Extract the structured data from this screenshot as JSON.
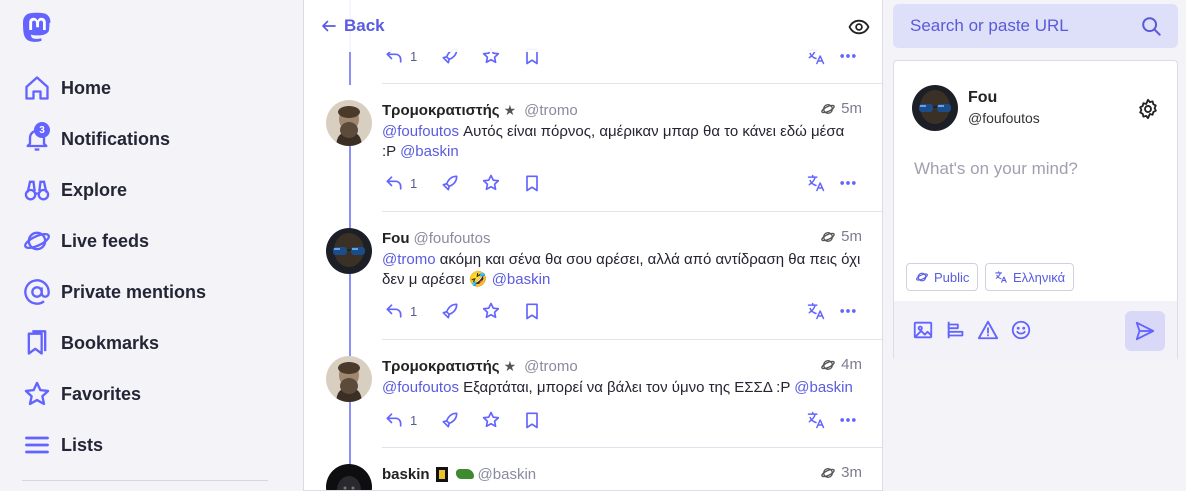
{
  "nav": {
    "items": [
      {
        "label": "Home",
        "icon": "home-icon"
      },
      {
        "label": "Notifications",
        "icon": "bell-icon",
        "badge": "3"
      },
      {
        "label": "Explore",
        "icon": "binoculars-icon"
      },
      {
        "label": "Live feeds",
        "icon": "planet-icon"
      },
      {
        "label": "Private mentions",
        "icon": "at-icon"
      },
      {
        "label": "Bookmarks",
        "icon": "bookmarks-icon"
      },
      {
        "label": "Favorites",
        "icon": "star-icon"
      },
      {
        "label": "Lists",
        "icon": "list-icon"
      }
    ]
  },
  "column": {
    "back_label": "Back",
    "statuses": [
      {
        "display_name": "Τρομοκρατιστής",
        "star": "★",
        "acct": "@tromo",
        "time": "5m",
        "content": [
          {
            "t": "@foufoutos",
            "m": true
          },
          {
            "t": " Αυτός είναι πόρνος, αμέρικαν μπαρ θα το κάνει εδώ μέσα :P ",
            "m": false
          },
          {
            "t": "@baskin",
            "m": true
          }
        ],
        "reply_count": "1"
      },
      {
        "display_name": "Fou",
        "star": "",
        "acct": "@foufoutos",
        "time": "5m",
        "content": [
          {
            "t": "@tromo",
            "m": true
          },
          {
            "t": " ακόμη και σένα θα σου αρέσει, αλλά από αντίδραση θα πεις όχι δεν μ αρέσει 🤣 ",
            "m": false
          },
          {
            "t": "@baskin",
            "m": true
          }
        ],
        "reply_count": "1"
      },
      {
        "display_name": "Τρομοκρατιστής",
        "star": "★",
        "acct": "@tromo",
        "time": "4m",
        "content": [
          {
            "t": "@foufoutos",
            "m": true
          },
          {
            "t": " Εξαρτάται, μπορεί να βάλει τον ύμνο της ΕΣΣΔ :P ",
            "m": false
          },
          {
            "t": "@baskin",
            "m": true
          }
        ],
        "reply_count": "1"
      },
      {
        "display_name": "baskin",
        "star": "",
        "acct": "@baskin",
        "time": "3m",
        "content": [],
        "reply_count": ""
      }
    ],
    "top_reply_count": "1"
  },
  "search": {
    "placeholder": "Search or paste URL"
  },
  "compose": {
    "name": "Fou",
    "acct": "@foufoutos",
    "placeholder": "What's on your mind?",
    "visibility": "Public",
    "language": "Ελληνικά"
  },
  "colors": {
    "accent": "#6364ff",
    "background": "#f3f3f8"
  }
}
